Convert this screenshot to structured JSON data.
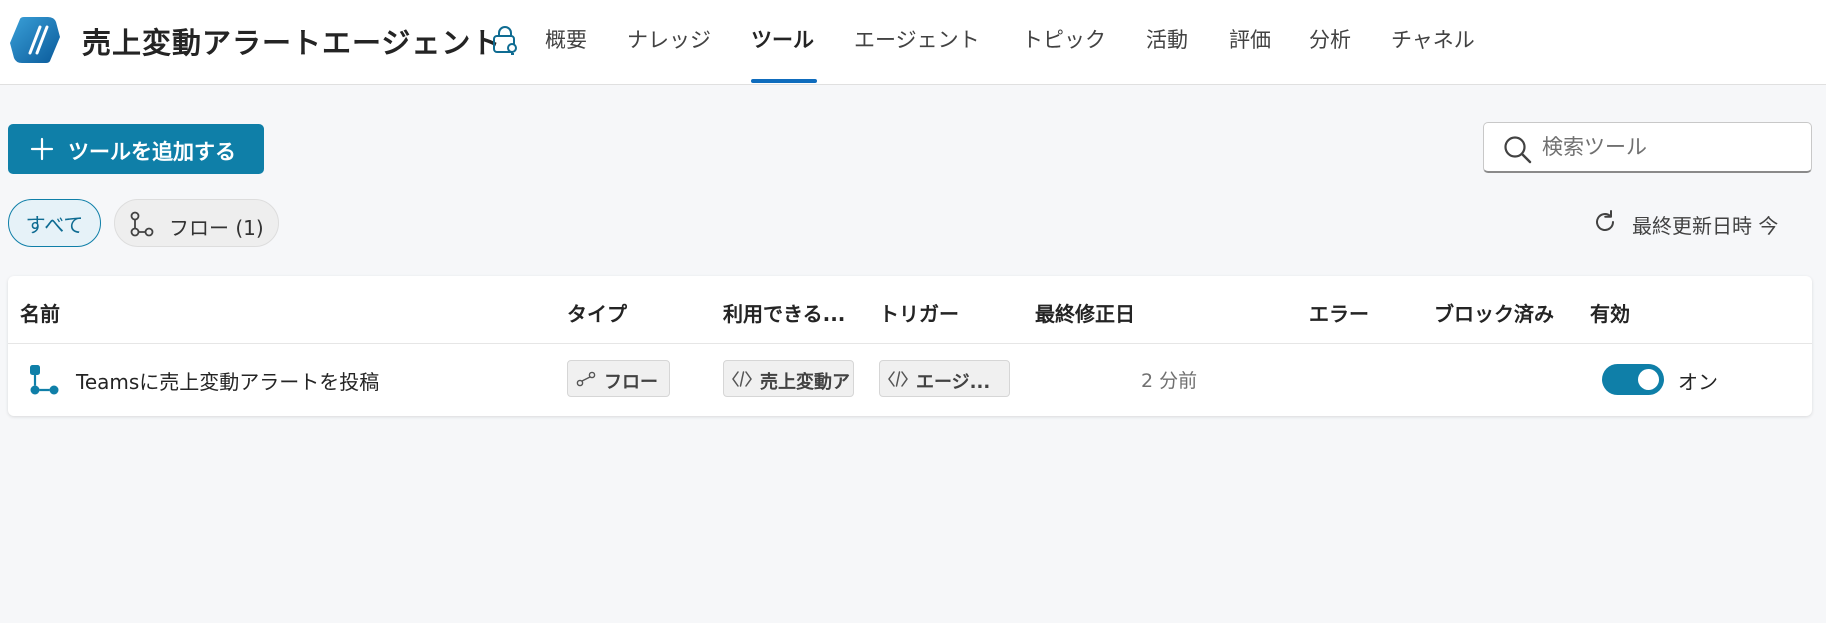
{
  "header": {
    "title": "売上変動アラートエージェント",
    "tabs": [
      {
        "label": "概要"
      },
      {
        "label": "ナレッジ"
      },
      {
        "label": "ツール",
        "active": true
      },
      {
        "label": "エージェント"
      },
      {
        "label": "トピック"
      },
      {
        "label": "活動"
      },
      {
        "label": "評価"
      },
      {
        "label": "分析"
      },
      {
        "label": "チャネル"
      }
    ]
  },
  "toolbar": {
    "add_label": "ツールを追加する",
    "search_placeholder": "検索ツール"
  },
  "filters": {
    "all_label": "すべて",
    "flow_label": "フロー (1)"
  },
  "status": {
    "updated_label": "最終更新日時 今"
  },
  "table": {
    "columns": [
      "名前",
      "タイプ",
      "利用できる...",
      "トリガー",
      "最終修正日",
      "エラー",
      "ブロック済み",
      "有効"
    ],
    "rows": [
      {
        "name": "Teamsに売上変動アラートを投稿",
        "type": "フロー",
        "available": "売上変動ア",
        "trigger": "エージ...",
        "modified": "2 分前",
        "error": "",
        "blocked": "",
        "enabled": true,
        "enabled_label": "オン"
      }
    ]
  },
  "colors": {
    "accent": "#0f7fa8",
    "tab_underline": "#0f6cbd"
  },
  "icons": [
    "copilot-logo-icon",
    "bag-key-icon",
    "plus-icon",
    "search-icon",
    "flow-icon",
    "refresh-icon",
    "code-icon"
  ]
}
